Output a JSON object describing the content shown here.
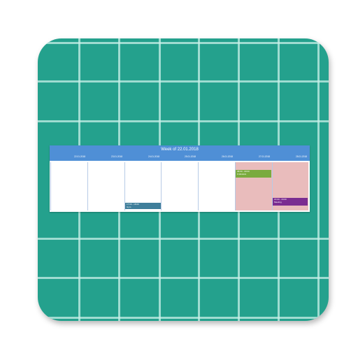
{
  "calendar": {
    "title": "Week of 22.01.2018",
    "days": [
      {
        "date": "22.01.2018",
        "weekend": false
      },
      {
        "date": "23.01.2018",
        "weekend": false
      },
      {
        "date": "24.01.2018",
        "weekend": false
      },
      {
        "date": "25.01.2018",
        "weekend": false
      },
      {
        "date": "26.01.2018",
        "weekend": false
      },
      {
        "date": "27.01.2018",
        "weekend": true
      },
      {
        "date": "28.01.2018",
        "weekend": true
      }
    ],
    "events": [
      {
        "day": 2,
        "time": "17:00 - 18:00",
        "name": "Gym",
        "color": "#3f7e9a"
      },
      {
        "day": 5,
        "time": "08:00 - 09:00",
        "name": "Frühstück",
        "color": "#7aab3e"
      },
      {
        "day": 6,
        "time": "15:00 - 16:00",
        "name": "Meeting",
        "color": "#7a2d91"
      }
    ]
  },
  "colors": {
    "icon_background": "#24a18d",
    "header_blue": "#4f8fd6",
    "weekend_pink": "#e9bcbc"
  }
}
